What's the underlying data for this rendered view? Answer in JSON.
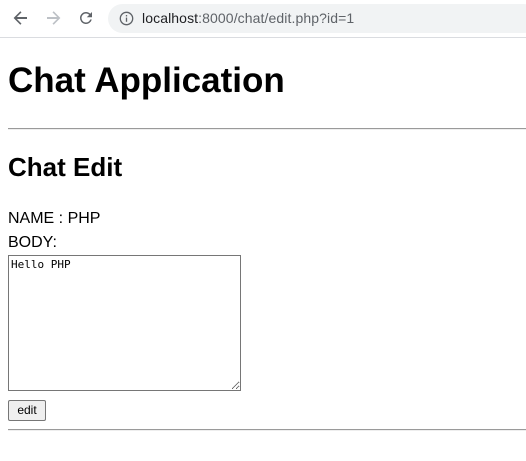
{
  "browser": {
    "url_host": "localhost",
    "url_path": ":8000/chat/edit.php?id=1",
    "icons": {
      "back": "back-arrow-icon",
      "forward": "forward-arrow-icon",
      "reload": "reload-icon",
      "site_info": "info-icon"
    }
  },
  "page": {
    "title": "Chat Application",
    "section_title": "Chat Edit",
    "name_line": "NAME : PHP",
    "body_label": "BODY:",
    "body_value": "Hello PHP",
    "edit_button_label": "edit"
  }
}
